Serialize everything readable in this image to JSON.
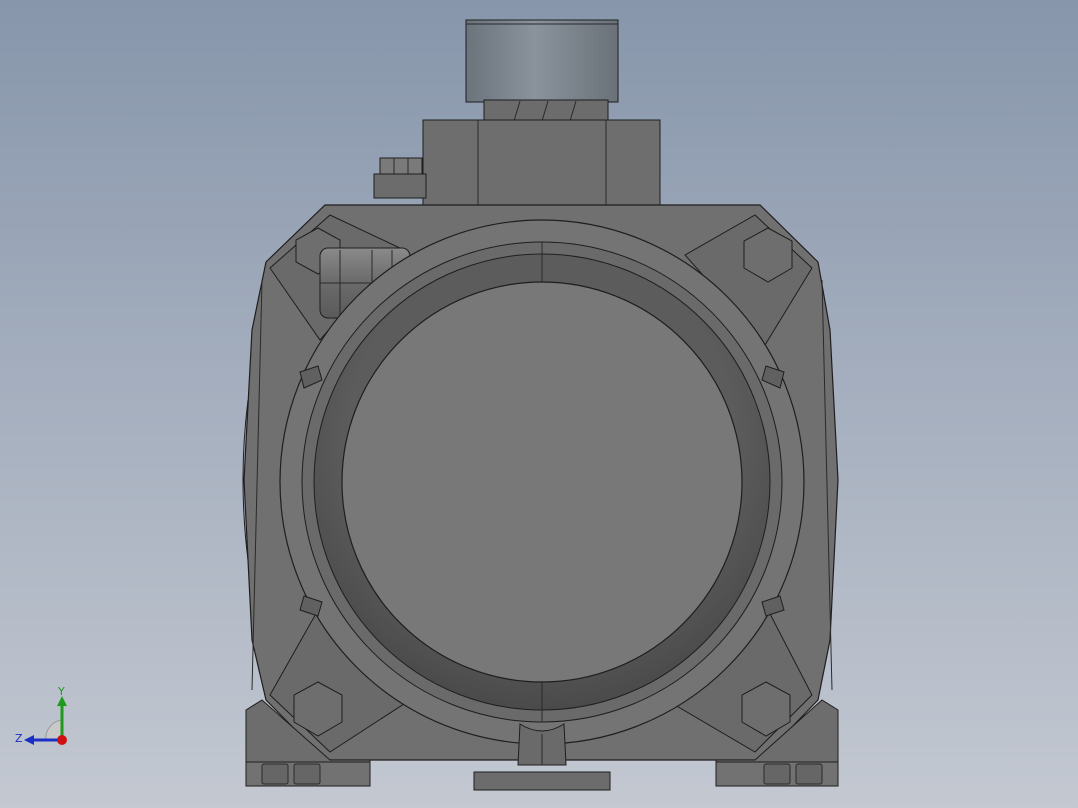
{
  "viewport": {
    "background_top": "#8796ab",
    "background_bottom": "#c3c8d1",
    "model_body_color": "#6f6f6f",
    "model_edge_color": "#1e1e1e",
    "cap_color": "#7e8790"
  },
  "triad": {
    "y_label": "Y",
    "z_label": "Z",
    "y_color": "#1f9a1f",
    "z_color": "#1a2fc7",
    "x_color": "#d01010"
  }
}
